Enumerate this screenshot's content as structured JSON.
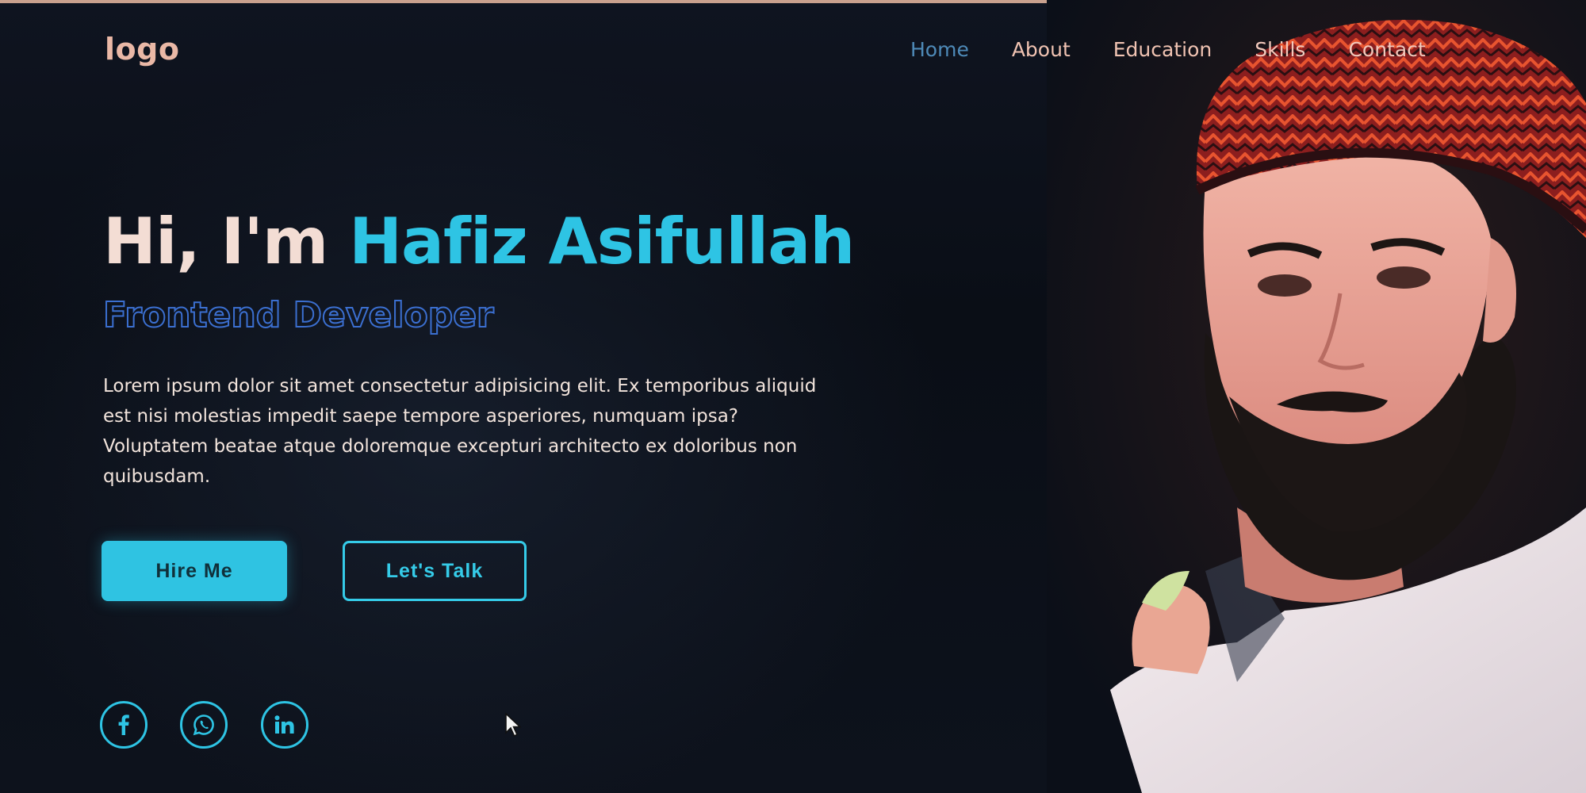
{
  "nav": {
    "logo": "logo",
    "links": [
      {
        "label": "Home",
        "active": true
      },
      {
        "label": "About",
        "active": false
      },
      {
        "label": "Education",
        "active": false
      },
      {
        "label": "Skills",
        "active": false
      },
      {
        "label": "Contact",
        "active": false
      }
    ]
  },
  "hero": {
    "greeting": "Hi, I'm",
    "name": "Hafiz Asifullah",
    "role": "Frontend Developer",
    "bio": "Lorem ipsum dolor sit amet consectetur adipisicing elit. Ex temporibus aliquid est nisi molestias impedit saepe tempore asperiores, numquam ipsa? Voluptatem beatae atque doloremque excepturi architecto ex doloribus non quibusdam.",
    "buttons": {
      "hire": "Hire Me",
      "talk": "Let's Talk"
    }
  },
  "social": {
    "icons": [
      "facebook-icon",
      "whatsapp-icon",
      "linkedin-icon"
    ]
  },
  "colors": {
    "accent": "#2ec4e4",
    "background": "#0b0f18",
    "nav_text": "#f0c3b2",
    "nav_active": "#4e8ab8",
    "role_outline": "#3b6fd0"
  }
}
